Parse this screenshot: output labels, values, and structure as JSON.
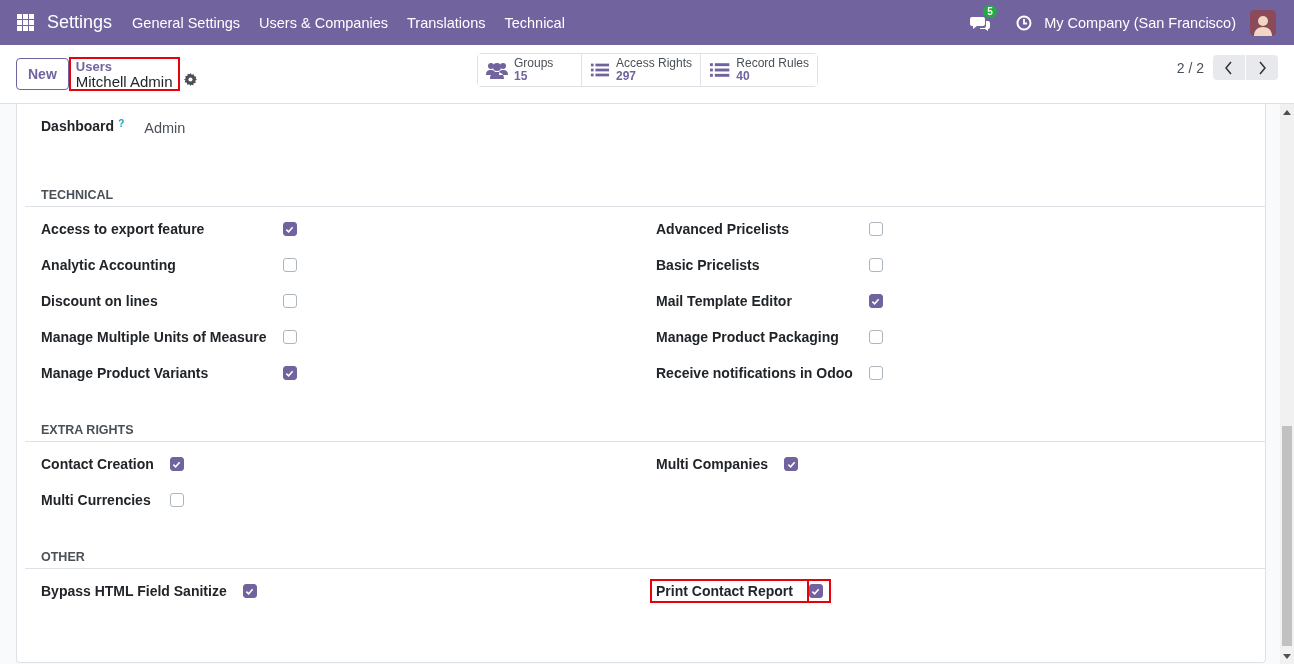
{
  "navbar": {
    "app_name": "Settings",
    "menu": [
      "General Settings",
      "Users & Companies",
      "Translations",
      "Technical"
    ],
    "messages_badge": "5",
    "company": "My Company (San Francisco)"
  },
  "control_panel": {
    "new_button": "New",
    "breadcrumb": {
      "parent": "Users",
      "current": "Mitchell Admin",
      "highlighted": true
    },
    "stat_buttons": [
      {
        "kind": "people",
        "label": "Groups",
        "value": "15"
      },
      {
        "kind": "list",
        "label": "Access Rights",
        "value": "297"
      },
      {
        "kind": "list",
        "label": "Record Rules",
        "value": "40"
      }
    ],
    "pager": "2 / 2"
  },
  "dashboard": {
    "label": "Dashboard",
    "help": "?",
    "value": "Admin"
  },
  "sections": [
    {
      "title": "TECHNICAL",
      "left": [
        {
          "label": "Access to export feature",
          "checked": true,
          "highlighted": false
        },
        {
          "label": "Analytic Accounting",
          "checked": false,
          "highlighted": false
        },
        {
          "label": "Discount on lines",
          "checked": false,
          "highlighted": false
        },
        {
          "label": "Manage Multiple Units of Measure",
          "checked": false,
          "highlighted": false
        },
        {
          "label": "Manage Product Variants",
          "checked": true,
          "highlighted": false
        }
      ],
      "right": [
        {
          "label": "Advanced Pricelists",
          "checked": false,
          "highlighted": false
        },
        {
          "label": "Basic Pricelists",
          "checked": false,
          "highlighted": false
        },
        {
          "label": "Mail Template Editor",
          "checked": true,
          "highlighted": false
        },
        {
          "label": "Manage Product Packaging",
          "checked": false,
          "highlighted": false
        },
        {
          "label": "Receive notifications in Odoo",
          "checked": false,
          "highlighted": false
        }
      ]
    },
    {
      "title": "EXTRA RIGHTS",
      "left": [
        {
          "label": "Contact Creation",
          "checked": true,
          "highlighted": false
        },
        {
          "label": "Multi Currencies",
          "checked": false,
          "highlighted": false
        }
      ],
      "right": [
        {
          "label": "Multi Companies",
          "checked": true,
          "highlighted": false
        }
      ]
    },
    {
      "title": "OTHER",
      "left": [
        {
          "label": "Bypass HTML Field Sanitize",
          "checked": true,
          "highlighted": false
        }
      ],
      "right": [
        {
          "label": "Print Contact Report",
          "checked": true,
          "highlighted": true
        }
      ]
    }
  ]
}
